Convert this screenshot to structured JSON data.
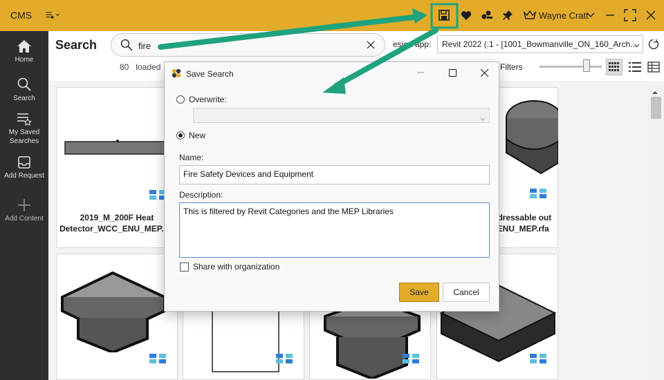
{
  "app": {
    "logo": "CMS",
    "user_name": "Wayne Cratt",
    "accent_color": "#e2ac2a",
    "toolbar_icons": [
      "favorites-filter-icon",
      "save-icon",
      "heart-icon",
      "share-icon",
      "pin-icon",
      "crown-icon",
      "minimize-icon",
      "maximize-icon",
      "close-icon"
    ]
  },
  "sidebar": {
    "items": [
      {
        "label": "Home",
        "icon": "home-icon"
      },
      {
        "label": "Search",
        "icon": "search-icon"
      },
      {
        "label": "My Saved Searches",
        "icon": "saved-searches-icon"
      },
      {
        "label": "Add Request",
        "icon": "inbox-icon"
      },
      {
        "label": "Add Content",
        "icon": "plus-icon"
      }
    ]
  },
  "main": {
    "title": "Search",
    "search_value": "fire",
    "results_count": "80",
    "results_suffix": "loaded",
    "design_app_label": "esign app:",
    "design_app_value": "Revit 2022 (.1 - [1001_Bowmanville_ON_160_Arch...",
    "filters_label": "0 Filters",
    "zoom_level": 0.7
  },
  "cards": [
    {
      "label": "2019_M_200F Heat Detector_WCC_ENU_MEP.rfa"
    },
    {
      "label": "ddressable out _ENU_MEP.rfa"
    },
    {
      "label": ""
    },
    {
      "label": ""
    },
    {
      "label": ""
    },
    {
      "label": ""
    }
  ],
  "dialog": {
    "title": "Save Search",
    "overwrite_label": "Overwrite:",
    "overwrite_value": "",
    "new_label": "New",
    "selected_mode": "New",
    "name_label": "Name:",
    "name_value": "Fire Safety Devices and Equipment",
    "description_label": "Description:",
    "description_value": "This is filtered by Revit Categories and the MEP Libraries",
    "share_label": "Share with organization",
    "share_checked": false,
    "save_label": "Save",
    "cancel_label": "Cancel"
  }
}
